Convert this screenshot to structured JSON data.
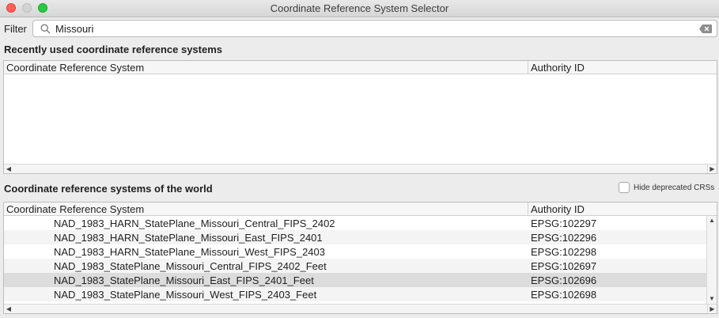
{
  "window": {
    "title": "Coordinate Reference System Selector"
  },
  "filter": {
    "label": "Filter",
    "value": "Missouri"
  },
  "recent": {
    "heading": "Recently used coordinate reference systems",
    "columns": [
      "Coordinate Reference System",
      "Authority ID"
    ],
    "rows": []
  },
  "world": {
    "heading": "Coordinate reference systems of the world",
    "hide_deprecated_label": "Hide deprecated CRSs",
    "hide_deprecated_checked": false,
    "columns": [
      "Coordinate Reference System",
      "Authority ID"
    ],
    "rows": [
      {
        "name": "NAD_1983_HARN_StatePlane_Missouri_Central_FIPS_2402",
        "id": "EPSG:102297",
        "selected": false
      },
      {
        "name": "NAD_1983_HARN_StatePlane_Missouri_East_FIPS_2401",
        "id": "EPSG:102296",
        "selected": false
      },
      {
        "name": "NAD_1983_HARN_StatePlane_Missouri_West_FIPS_2403",
        "id": "EPSG:102298",
        "selected": false
      },
      {
        "name": "NAD_1983_StatePlane_Missouri_Central_FIPS_2402_Feet",
        "id": "EPSG:102697",
        "selected": false
      },
      {
        "name": "NAD_1983_StatePlane_Missouri_East_FIPS_2401_Feet",
        "id": "EPSG:102696",
        "selected": true
      },
      {
        "name": "NAD_1983_StatePlane_Missouri_West_FIPS_2403_Feet",
        "id": "EPSG:102698",
        "selected": false
      }
    ]
  },
  "icons": {
    "search": "search-icon",
    "clear": "clear-icon",
    "scroll_left": "scroll-left-icon",
    "scroll_right": "scroll-right-icon",
    "scroll_up": "scroll-up-icon",
    "scroll_down": "scroll-down-icon"
  },
  "colors": {
    "close": "#fe5f57",
    "minimize": "#d3d3d3",
    "maximize": "#28c840",
    "selected_row": "#dcdcdc"
  }
}
